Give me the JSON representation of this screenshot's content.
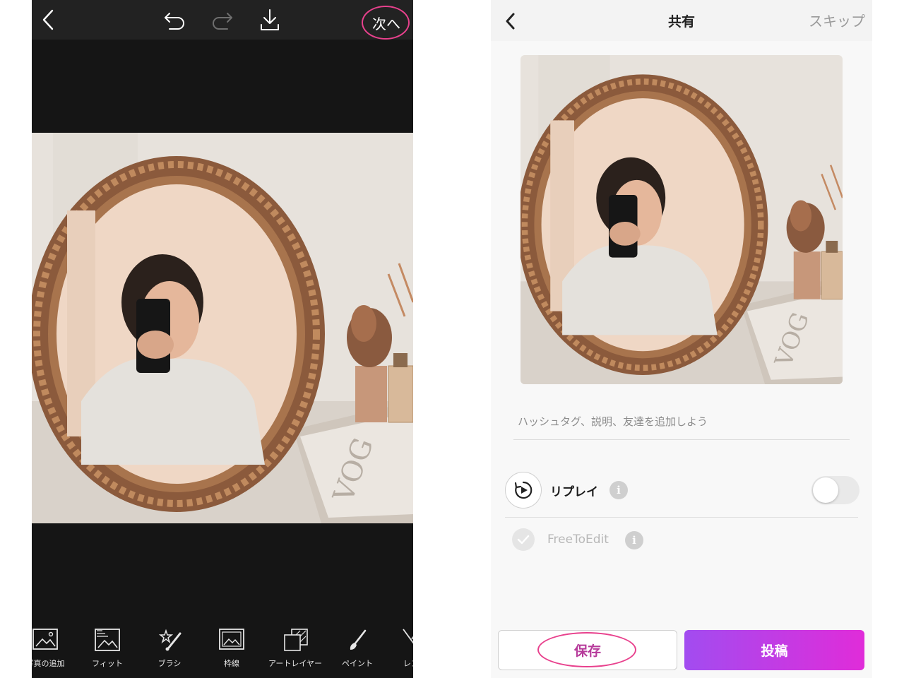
{
  "editor": {
    "next_label": "次へ",
    "icons": [
      "back-chevron-icon",
      "undo-icon",
      "redo-icon",
      "download-icon"
    ],
    "tools": [
      {
        "label": "写真の追加",
        "icon": "add-photo-icon"
      },
      {
        "label": "フィット",
        "icon": "fit-icon"
      },
      {
        "label": "ブラシ",
        "icon": "brush-icon"
      },
      {
        "label": "枠線",
        "icon": "border-icon"
      },
      {
        "label": "アートレイヤー",
        "icon": "art-layer-icon"
      },
      {
        "label": "ペイント",
        "icon": "paint-icon"
      },
      {
        "label": "レン",
        "icon": "lens-icon"
      }
    ],
    "highlight_color": "#e8418d"
  },
  "share": {
    "title": "共有",
    "skip_label": "スキップ",
    "caption_placeholder": "ハッシュタグ、説明、友達を追加しよう",
    "replay_label": "リプレイ",
    "replay_enabled": false,
    "free_to_edit_label": "FreeToEdit",
    "info_glyph": "i",
    "save_label": "保存",
    "post_label": "投稿",
    "post_gradient": [
      "#a24cf0",
      "#e02cd9"
    ]
  }
}
